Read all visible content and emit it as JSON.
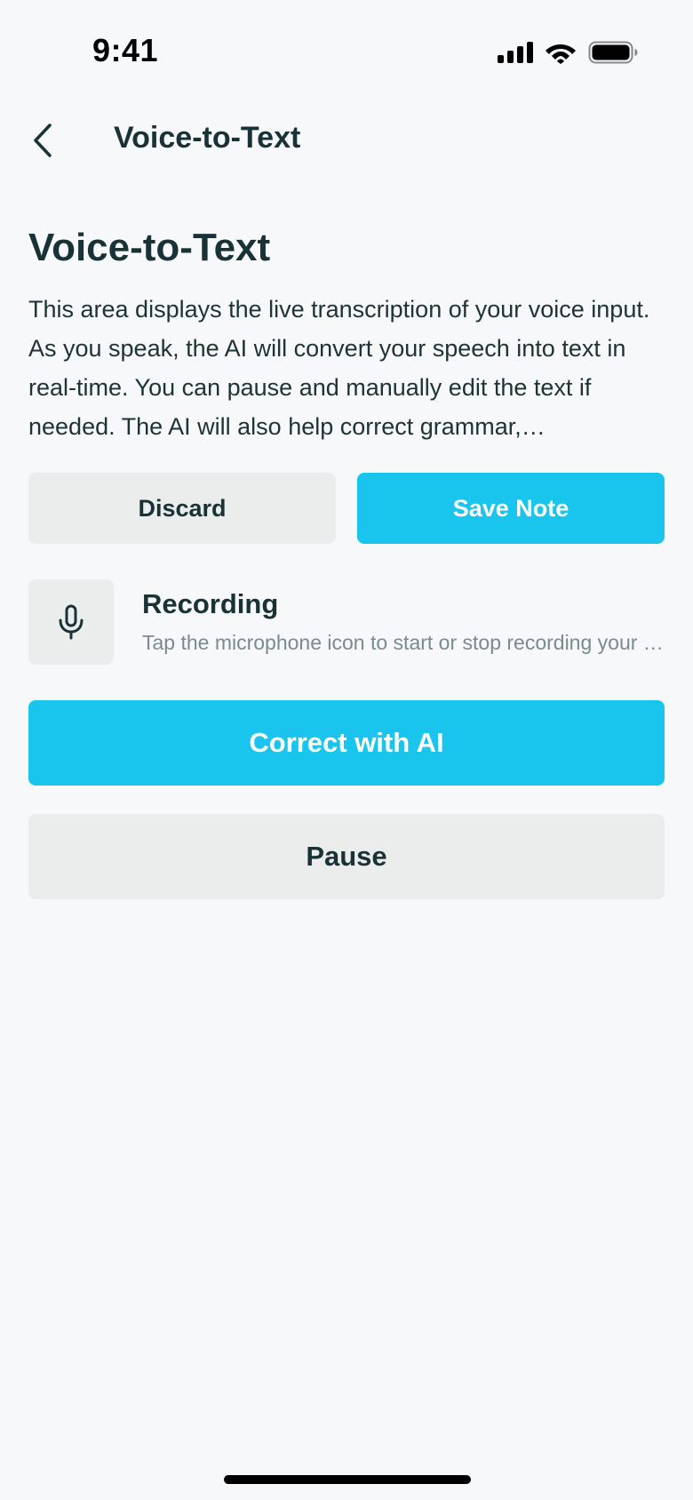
{
  "status_bar": {
    "time": "9:41"
  },
  "nav": {
    "title": "Voice-to-Text"
  },
  "main": {
    "title": "Voice-to-Text",
    "description": "This area displays the live transcription of your voice input. As you speak, the AI will convert your speech into text in real-time. You can pause and manually edit the text if needed. The AI will also help correct grammar,…",
    "discard_label": "Discard",
    "save_label": "Save Note",
    "recording": {
      "title": "Recording",
      "subtitle": "Tap the microphone icon to start or stop recording your voice."
    },
    "correct_label": "Correct with AI",
    "pause_label": "Pause"
  },
  "icons": {
    "back": "chevron-left-icon",
    "mic": "microphone-icon",
    "signal": "cellular-signal-icon",
    "wifi": "wifi-icon",
    "battery": "battery-icon"
  },
  "colors": {
    "background": "#f6f8fa",
    "primary": "#19c5ec",
    "secondary": "#eaedec",
    "text": "#193236",
    "muted_text": "#7d8a8b"
  }
}
